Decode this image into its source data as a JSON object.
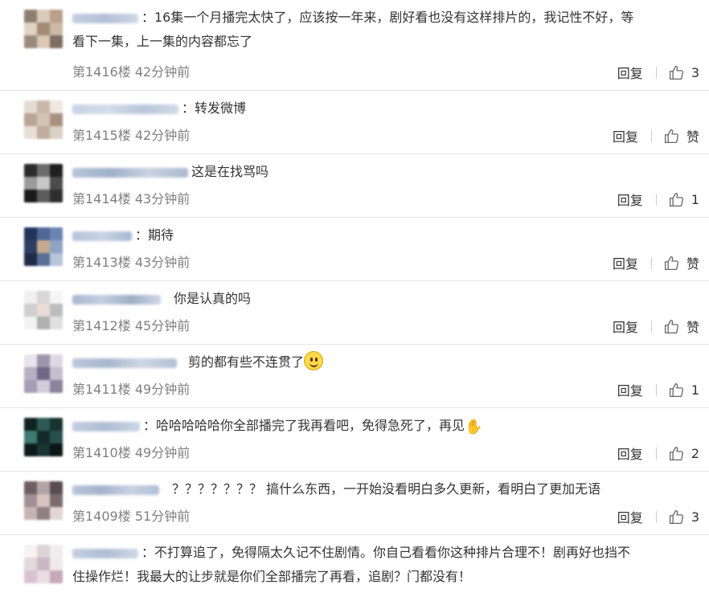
{
  "comments": [
    {
      "floor": "第1416楼",
      "time": "42分钟前",
      "reply": "回复",
      "likes": "3",
      "line1": "：16集一个月播完太快了，应该按一年来，剧好看也没有这样排片的，我记性不好，等",
      "line2": "看下一集，上一集的内容都忘了"
    },
    {
      "floor": "第1415楼",
      "time": "42分钟前",
      "reply": "回复",
      "likes": "赞",
      "line1": "：转发微博"
    },
    {
      "floor": "第1414楼",
      "time": "43分钟前",
      "reply": "回复",
      "likes": "1",
      "line1": "这是在找骂吗"
    },
    {
      "floor": "第1413楼",
      "time": "43分钟前",
      "reply": "回复",
      "likes": "赞",
      "line1": "：期待"
    },
    {
      "floor": "第1412楼",
      "time": "45分钟前",
      "reply": "回复",
      "likes": "赞",
      "line1": "你是认真的吗"
    },
    {
      "floor": "第1411楼",
      "time": "49分钟前",
      "reply": "回复",
      "likes": "1",
      "line1": "剪的都有些不连贯了"
    },
    {
      "floor": "第1410楼",
      "time": "49分钟前",
      "reply": "回复",
      "likes": "2",
      "line1": "：哈哈哈哈哈你全部播完了我再看吧，免得急死了，再见"
    },
    {
      "floor": "第1409楼",
      "time": "51分钟前",
      "reply": "回复",
      "likes": "3",
      "line1": "？？？？？？？ 搞什么东西，一开始没看明白多久更新，看明白了更加无语"
    },
    {
      "floor": "",
      "time": "",
      "reply": "",
      "likes": "",
      "line1": "：不打算追了，免得隔太久记不住剧情。你自己看看你这种排片合理不！剧再好也挡不",
      "line2": "住操作烂！我最大的让步就是你们全部播完了再看，追剧？门都没有！"
    }
  ],
  "icons": {
    "like": "thumbs-up-icon",
    "smile": "smile-emoji-icon",
    "wave": "waving-hand-emoji-icon"
  },
  "colors": {
    "text": "#333333",
    "meta": "#808080",
    "divider": "#e6e6e6"
  }
}
